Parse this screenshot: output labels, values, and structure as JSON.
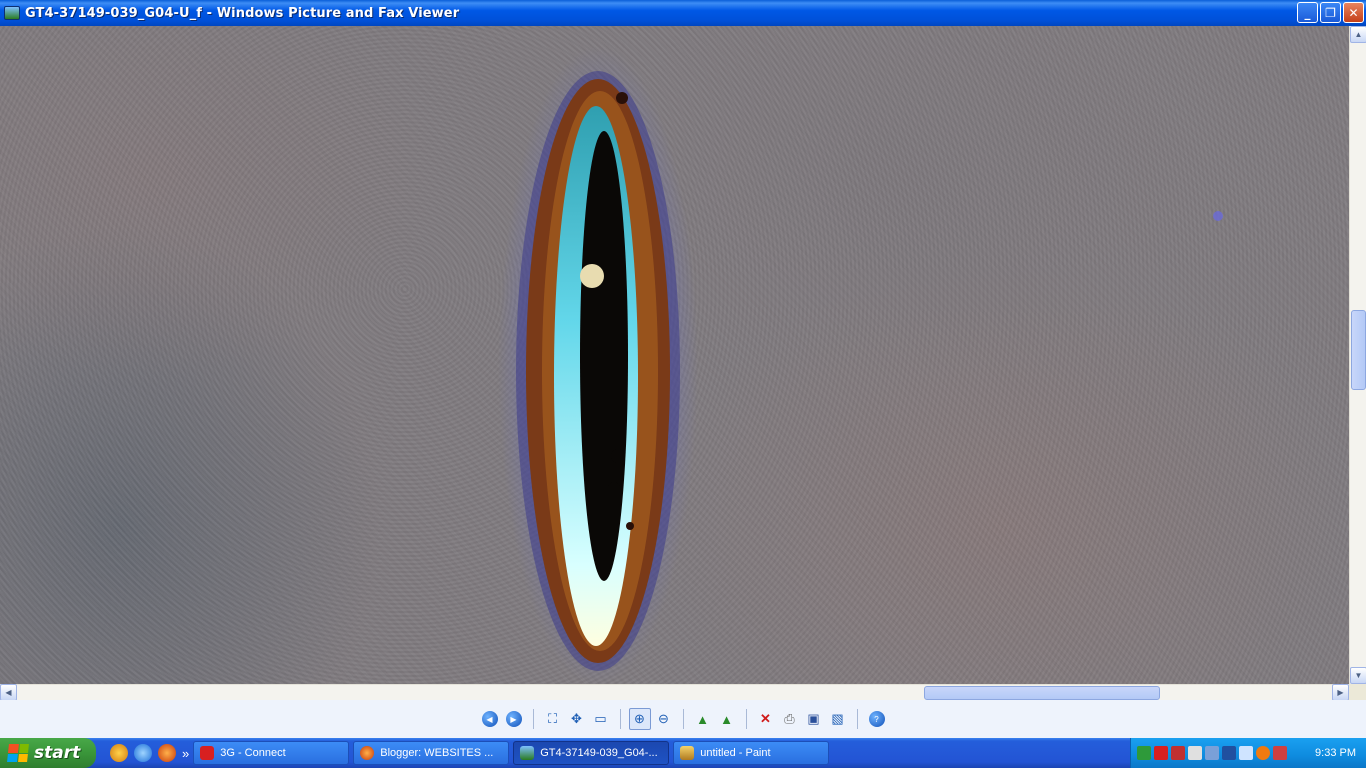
{
  "window": {
    "title": "GT4-37149-039_G04-U_f - Windows Picture and Fax Viewer",
    "buttons": {
      "minimize": "_",
      "maximize": "❐",
      "close": "✕"
    }
  },
  "toolbar": {
    "icons": [
      "previous-image-icon",
      "next-image-icon",
      "best-fit-icon",
      "actual-size-icon",
      "slide-show-icon",
      "zoom-in-icon",
      "zoom-out-icon",
      "rotate-clockwise-icon",
      "rotate-counterclockwise-icon",
      "delete-icon",
      "print-icon",
      "save-copy-icon",
      "open-for-editing-icon",
      "help-icon"
    ],
    "active": "zoom-in-icon"
  },
  "taskbar": {
    "start_label": "start",
    "tasks": [
      {
        "label": "3G - Connect",
        "icon": "connect-icon"
      },
      {
        "label": "Blogger: WEBSITES ...",
        "icon": "firefox-icon"
      },
      {
        "label": "GT4-37149-039_G04-...",
        "icon": "picture-viewer-icon",
        "active": true
      },
      {
        "label": "untitled - Paint",
        "icon": "paint-icon"
      }
    ],
    "clock": "9:33 PM"
  },
  "colors": {
    "titlebar": "#0058e6",
    "start": "#3a963a",
    "taskbar": "#245edb",
    "tray": "#0e8bdf"
  }
}
